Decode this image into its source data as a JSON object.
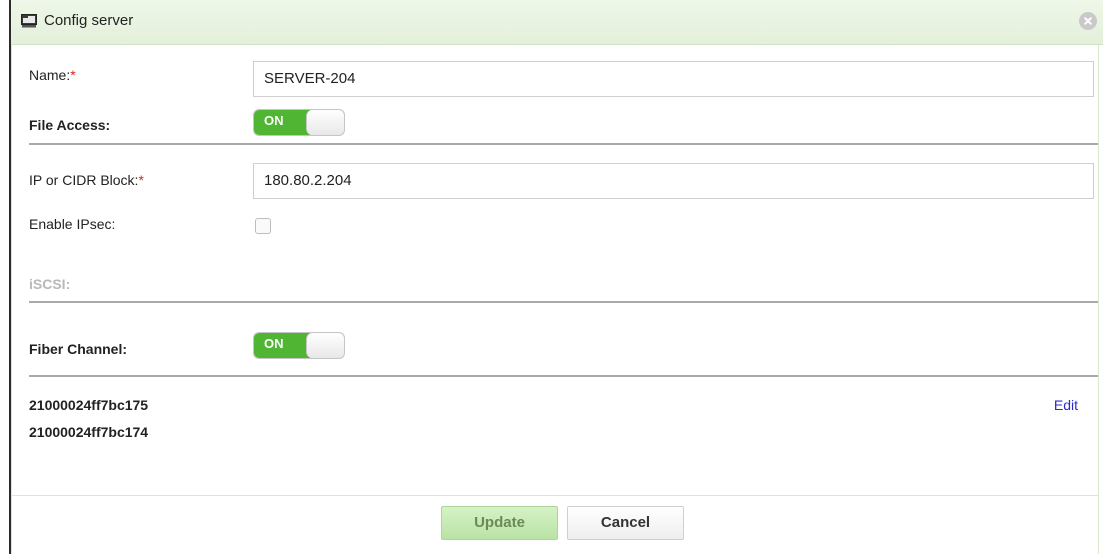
{
  "dialog": {
    "title": "Config server",
    "icon": "server-terminal-icon",
    "close_icon": "close-icon"
  },
  "form": {
    "name_label": "Name:",
    "required_mark": "*",
    "name_value": "SERVER-204",
    "file_access_label": "File Access:",
    "file_access_toggle": "ON",
    "ip_label": "IP or CIDR Block:",
    "ip_value": "180.80.2.204",
    "ipsec_label": "Enable IPsec:",
    "iscsi_label": "iSCSI:",
    "fiber_label": "Fiber Channel:",
    "fiber_toggle": "ON",
    "wwns": [
      "21000024ff7bc175",
      "21000024ff7bc174"
    ],
    "edit_label": "Edit"
  },
  "footer": {
    "update_label": "Update",
    "cancel_label": "Cancel"
  },
  "colors": {
    "accent_green": "#4fb533",
    "link_blue": "#2b2bd0",
    "required_red": "#e02020"
  }
}
